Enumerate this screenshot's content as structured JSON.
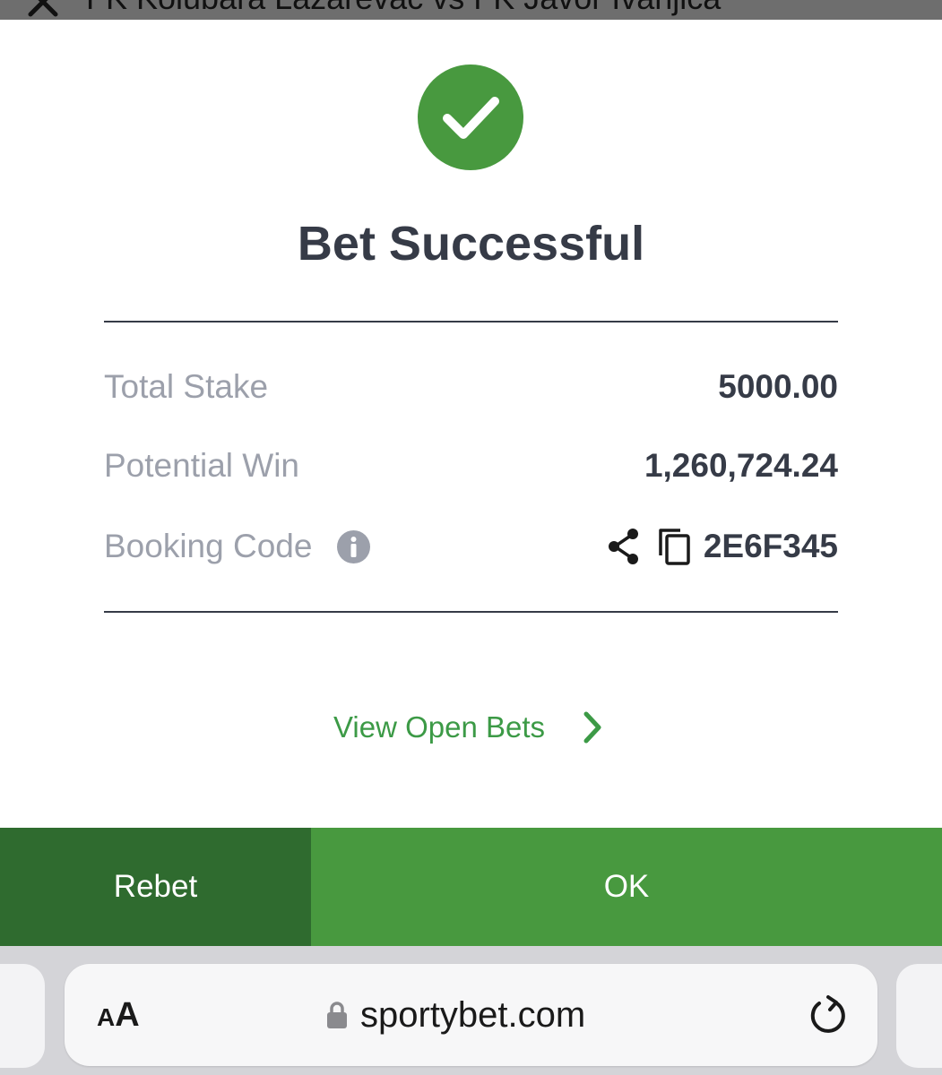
{
  "top_bar": {
    "match_title": "FK Kolubara Lazarevac vs FK Javor Ivanjica"
  },
  "modal": {
    "title": "Bet Successful",
    "rows": [
      {
        "label": "Total Stake",
        "value": "5000.00"
      },
      {
        "label": "Potential Win",
        "value": "1,260,724.24"
      },
      {
        "label": "Booking Code",
        "value": "2E6F345"
      }
    ],
    "view_open_bets": "View Open Bets"
  },
  "buttons": {
    "rebet": "Rebet",
    "ok": "OK"
  },
  "browser": {
    "text_size_small": "A",
    "text_size_big": "A",
    "url": "sportybet.com"
  },
  "colors": {
    "success_green": "#48993f",
    "rebet_green": "#2f6b2f",
    "text_dark": "#363b47",
    "text_muted": "#9ca0ab"
  },
  "icons": [
    "close-icon",
    "check-circle-icon",
    "info-icon",
    "share-icon",
    "copy-icon",
    "chevron-right-icon",
    "lock-icon",
    "reload-icon"
  ]
}
